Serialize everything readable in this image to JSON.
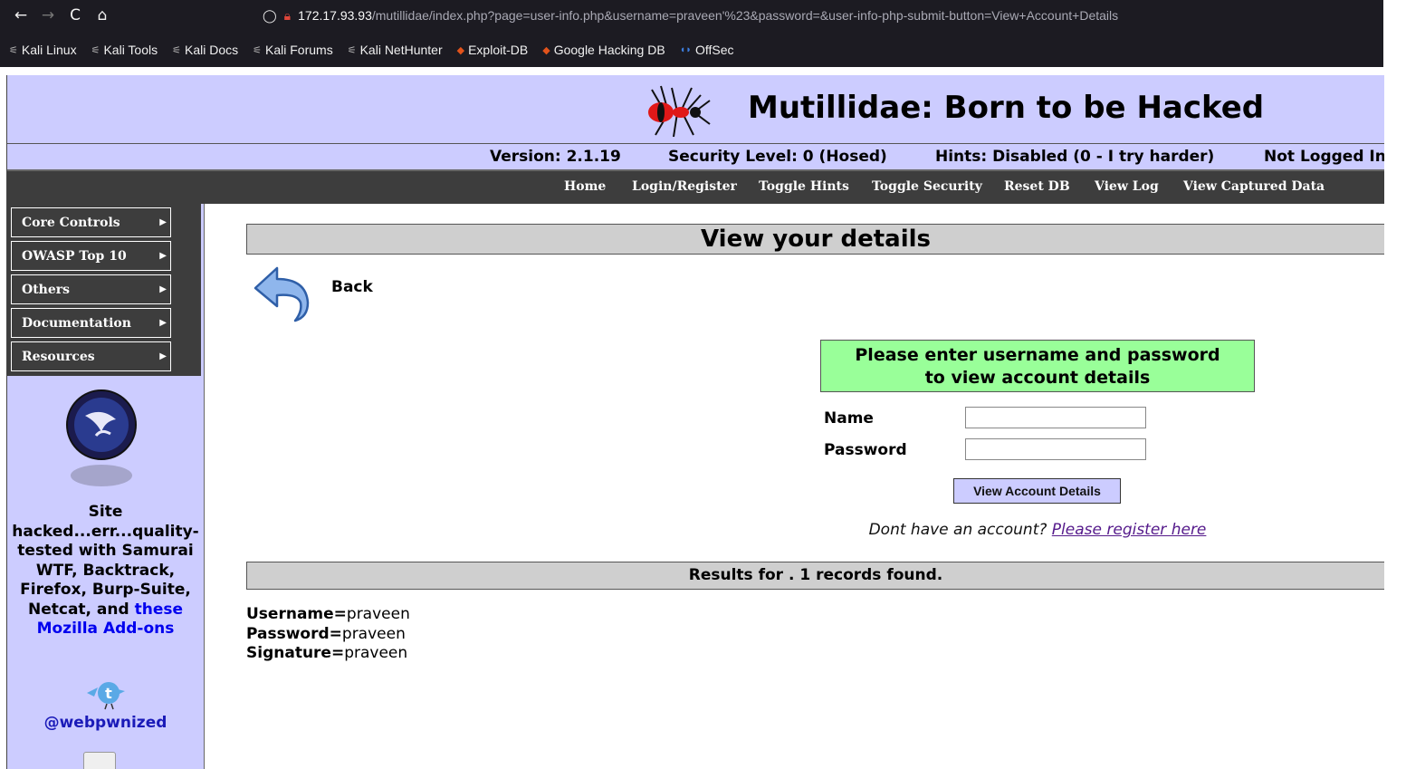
{
  "browser": {
    "nav_back": "←",
    "nav_forward": "→",
    "nav_reload": "C",
    "nav_home": "⌂",
    "url_host": "172.17.93.93",
    "url_rest": "/mutillidae/index.php?page=user-info.php&username=praveen'%23&password=&user-info-php-submit-button=View+Account+Details",
    "bookmarks": [
      {
        "label": "Kali Linux",
        "icon": "kali-icon"
      },
      {
        "label": "Kali Tools",
        "icon": "kali-icon"
      },
      {
        "label": "Kali Docs",
        "icon": "kali-icon"
      },
      {
        "label": "Kali Forums",
        "icon": "kali-icon"
      },
      {
        "label": "Kali NetHunter",
        "icon": "kali-icon"
      },
      {
        "label": "Exploit-DB",
        "icon": "exploit-db-icon"
      },
      {
        "label": "Google Hacking DB",
        "icon": "exploit-db-icon"
      },
      {
        "label": "OffSec",
        "icon": "offsec-icon"
      }
    ]
  },
  "header": {
    "title": "Mutillidae: Born to be Hacked",
    "version": "Version: 2.1.19",
    "security": "Security Level: 0 (Hosed)",
    "hints": "Hints: Disabled (0 - I try harder)",
    "login_status": "Not Logged In"
  },
  "menu": [
    "Home",
    "Login/Register",
    "Toggle Hints",
    "Toggle Security",
    "Reset DB",
    "View Log",
    "View Captured Data"
  ],
  "sidebar": {
    "items": [
      "Core Controls",
      "OWASP Top 10",
      "Others",
      "Documentation",
      "Resources"
    ],
    "blurb_text": "Site hacked...err...quality-tested with Samurai WTF, Backtrack, Firefox, Burp-Suite, Netcat, and ",
    "blurb_link": "these Mozilla Add-ons",
    "twitter": "@webpwnized"
  },
  "main": {
    "title": "View your details",
    "back": "Back",
    "form_prompt_1": "Please enter username and password",
    "form_prompt_2": "to view account details",
    "name_label": "Name",
    "password_label": "Password",
    "name_value": "",
    "password_value": "",
    "submit": "View Account Details",
    "register_prefix": "Dont have an account? ",
    "register_link": "Please register here",
    "results_header": "Results for . 1 records found.",
    "results": [
      {
        "key": "Username=",
        "value": "praveen"
      },
      {
        "key": "Password=",
        "value": "praveen"
      },
      {
        "key": "Signature=",
        "value": "praveen"
      }
    ]
  },
  "colors": {
    "header_bg": "#ccccff",
    "menu_bg": "#3d3d3d",
    "form_prompt_bg": "#99ff99",
    "section_head_bg": "#cfcfcf"
  }
}
